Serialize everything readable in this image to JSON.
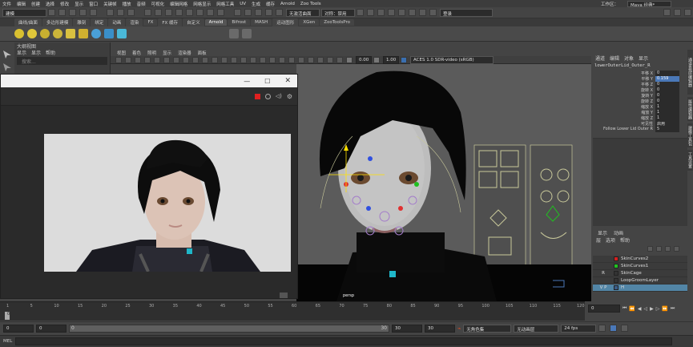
{
  "menubar": {
    "items": [
      "文件",
      "编辑",
      "创建",
      "选择",
      "修改",
      "显示",
      "窗口",
      "关键帧",
      "播放",
      "音频",
      "可视化",
      "变形",
      "约束",
      "控制",
      "缓存",
      "Arnold",
      "帮助"
    ],
    "extra_items": [
      "编辑网格",
      "网格显示",
      "网格工具",
      "UV",
      "生成",
      "缓存",
      "Arnold",
      "Zoo Tools"
    ],
    "workspace_label": "工作区：",
    "workspace_value": "Maya 经典*"
  },
  "status": {
    "mode": "建模",
    "no_active_surface": "无激活曲面",
    "symmetry": "对称：禁用",
    "login": "登录"
  },
  "shelf_tabs": [
    "曲线/曲面",
    "多边形建模",
    "雕刻",
    "绑定",
    "动画",
    "渲染",
    "FX",
    "FX 缓存",
    "自定义",
    "Arnold",
    "Bifrost",
    "MASH",
    "运动图形",
    "XGen",
    "ZooToolsPro"
  ],
  "outliner": {
    "title": "大纲视图",
    "menu": [
      "显示",
      "显示",
      "帮助"
    ],
    "search_placeholder": "搜索..."
  },
  "viewport": {
    "menu": [
      "视图",
      "着色",
      "照明",
      "显示",
      "渲染器",
      "面板"
    ],
    "exposure": "0.00",
    "gamma": "1.00",
    "colorspace": "ACES 1.0 SDR-video (sRGB)",
    "camera_label": "persp"
  },
  "channel_box": {
    "tabs": [
      "通道",
      "编辑",
      "对象",
      "显示"
    ],
    "node_name": "lowerOuterLid_Outer_R",
    "channels": [
      {
        "name": "平移 X",
        "value": "0"
      },
      {
        "name": "平移 Y",
        "value": "0.159"
      },
      {
        "name": "平移 Z",
        "value": "0"
      },
      {
        "name": "旋转 X",
        "value": "0"
      },
      {
        "name": "旋转 Y",
        "value": "0"
      },
      {
        "name": "旋转 Z",
        "value": "0"
      },
      {
        "name": "缩放 X",
        "value": "1"
      },
      {
        "name": "缩放 Y",
        "value": "1"
      },
      {
        "name": "缩放 Z",
        "value": "1"
      },
      {
        "name": "可见性",
        "value": "启用"
      },
      {
        "name": "Follow Lower Lid Outer R",
        "value": "5"
      }
    ],
    "side_tabs": [
      "通道盒/层编辑器",
      "属性编辑器",
      "建模工具包",
      "工具设置"
    ]
  },
  "layers": {
    "tabs": [
      "显示",
      "动画"
    ],
    "menu": [
      "层",
      "选项",
      "帮助"
    ],
    "items": [
      {
        "name": "SkinCurves2",
        "color": "#d42020",
        "flag": ""
      },
      {
        "name": "SkinCurves1",
        "color": "#20c020",
        "flag": ""
      },
      {
        "name": "SkinCage",
        "color": "#333333",
        "flag": "R"
      },
      {
        "name": "LoopGroomLayer",
        "color": "#333333",
        "flag": ""
      },
      {
        "name": "H",
        "color": "#3a5d8a",
        "flag": "V P"
      }
    ]
  },
  "timeline": {
    "ticks": [
      "1",
      "5",
      "10",
      "15",
      "20",
      "25",
      "30",
      "35",
      "40",
      "45",
      "50",
      "55",
      "60",
      "65",
      "70",
      "75",
      "80",
      "85",
      "90",
      "95",
      "100",
      "105",
      "110",
      "115",
      "120"
    ],
    "current_frame": "0"
  },
  "range": {
    "start": "0",
    "start_inner": "0",
    "range_start": "0",
    "range_end": "30",
    "end_inner": "30",
    "end": "30",
    "character_set": "无角色集",
    "anim_layer": "无动画层",
    "fps": "24 fps"
  },
  "cmdline": {
    "label": "MEL"
  },
  "colors": {
    "accent": "#5285a6",
    "highlight": "#4a78b8"
  }
}
